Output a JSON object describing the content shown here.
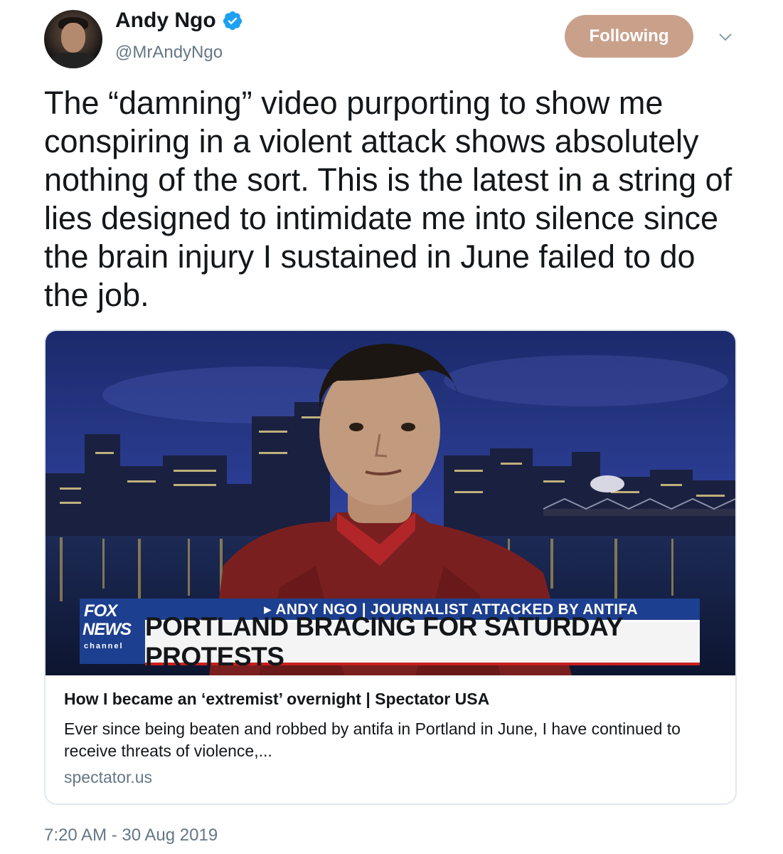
{
  "tweet": {
    "author": {
      "display_name": "Andy Ngo",
      "handle": "@MrAndyNgo",
      "verified": true
    },
    "follow_button_label": "Following",
    "text": "The “damning” video purporting to show me conspiring in a violent attack shows absolutely nothing of the sort. This is the latest in a string of lies designed to intimidate me into silence since the brain injury I sustained in June failed to do the job.",
    "card": {
      "image": {
        "chyron_upper": "▸ ANDY NGO | JOURNALIST ATTACKED BY ANTIFA",
        "chyron_lower": "PORTLAND BRACING FOR SATURDAY PROTESTS",
        "logo_line1": "FOX",
        "logo_line2": "NEWS",
        "logo_line3": "channel"
      },
      "title": "How I became an ‘extremist’ overnight | Spectator USA",
      "description": "Ever since being beaten and robbed by antifa in Portland in June, I have continued to receive threats of violence,...",
      "domain": "spectator.us"
    },
    "timestamp": "7:20 AM - 30 Aug 2019"
  },
  "colors": {
    "follow_button": "#c9a18b",
    "verified_badge": "#1da1f2",
    "secondary_text": "#657786",
    "card_border": "#e1e8ed",
    "chyron_blue": "#1d3f8f"
  },
  "icons": {
    "verified": "verified-badge-icon",
    "more": "chevron-down-icon"
  }
}
